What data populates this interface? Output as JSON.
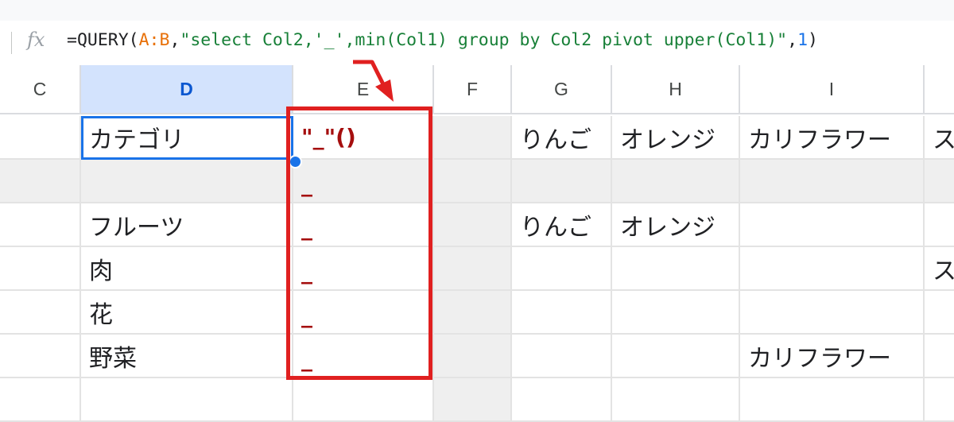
{
  "formula_bar": {
    "fx_icon": "fx",
    "parts": [
      {
        "text": "=QUERY(",
        "kind": "plain"
      },
      {
        "text": "A:B",
        "kind": "range"
      },
      {
        "text": ",",
        "kind": "plain"
      },
      {
        "text": "\"select Col2,'_',min(Col1) group by Col2 pivot upper(Col1)\"",
        "kind": "string"
      },
      {
        "text": ",",
        "kind": "plain"
      },
      {
        "text": "1",
        "kind": "number"
      },
      {
        "text": ")",
        "kind": "plain"
      }
    ]
  },
  "columns": [
    {
      "letter": "C",
      "selected": false
    },
    {
      "letter": "D",
      "selected": true
    },
    {
      "letter": "E",
      "selected": false
    },
    {
      "letter": "F",
      "selected": false
    },
    {
      "letter": "G",
      "selected": false
    },
    {
      "letter": "H",
      "selected": false
    },
    {
      "letter": "I",
      "selected": false
    },
    {
      "letter": "",
      "selected": false
    }
  ],
  "rows": [
    {
      "gray": false,
      "cells": [
        "",
        "カテゴリ",
        "\"_\"()",
        "",
        "りんご",
        "オレンジ",
        "カリフラワー",
        "ス"
      ]
    },
    {
      "gray": true,
      "cells": [
        "",
        "",
        "_",
        "",
        "",
        "",
        "",
        ""
      ]
    },
    {
      "gray": false,
      "cells": [
        "",
        "フルーツ",
        "_",
        "",
        "りんご",
        "オレンジ",
        "",
        ""
      ]
    },
    {
      "gray": false,
      "cells": [
        "",
        "肉",
        "_",
        "",
        "",
        "",
        "",
        "ス"
      ]
    },
    {
      "gray": false,
      "cells": [
        "",
        "花",
        "_",
        "",
        "",
        "",
        "",
        ""
      ]
    },
    {
      "gray": false,
      "cells": [
        "",
        "野菜",
        "_",
        "",
        "",
        "",
        "カリフラワー",
        ""
      ]
    },
    {
      "gray": false,
      "cells": [
        "",
        "",
        "",
        "",
        "",
        "",
        "",
        ""
      ]
    }
  ],
  "colors": {
    "selection": "#1a73e8",
    "annotation": "#e02020",
    "error_text": "#a50e0e",
    "string": "#188038",
    "range": "#e8710a"
  }
}
